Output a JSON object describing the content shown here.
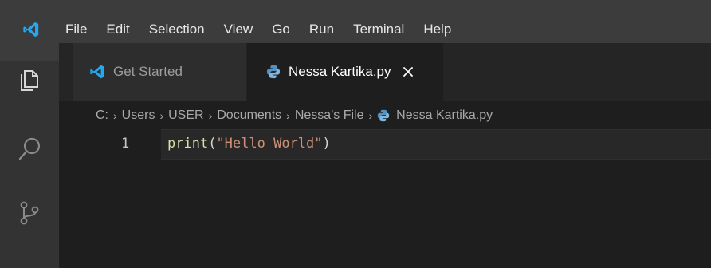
{
  "menubar": {
    "items": [
      "File",
      "Edit",
      "Selection",
      "View",
      "Go",
      "Run",
      "Terminal",
      "Help"
    ]
  },
  "tabs": [
    {
      "label": "Get Started",
      "icon": "vscode-icon",
      "active": false
    },
    {
      "label": "Nessa Kartika.py",
      "icon": "python-file-icon",
      "active": true,
      "close": "✕"
    }
  ],
  "breadcrumb": {
    "parts": [
      "C:",
      "Users",
      "USER",
      "Documents",
      "Nessa's File"
    ],
    "file": "Nessa Kartika.py",
    "separator": "›"
  },
  "editor": {
    "line_number": "1",
    "code": {
      "fn": "print",
      "open": "(",
      "str": "\"Hello World\"",
      "close": ")"
    }
  },
  "colors": {
    "accent": "#23a9f2",
    "menubar_bg": "#3c3c3c",
    "editor_bg": "#1e1e1e",
    "function": "#dcdcaa",
    "string": "#ce9178"
  },
  "activitybar": {
    "icons": [
      "files-icon",
      "search-icon",
      "source-control-icon"
    ]
  }
}
